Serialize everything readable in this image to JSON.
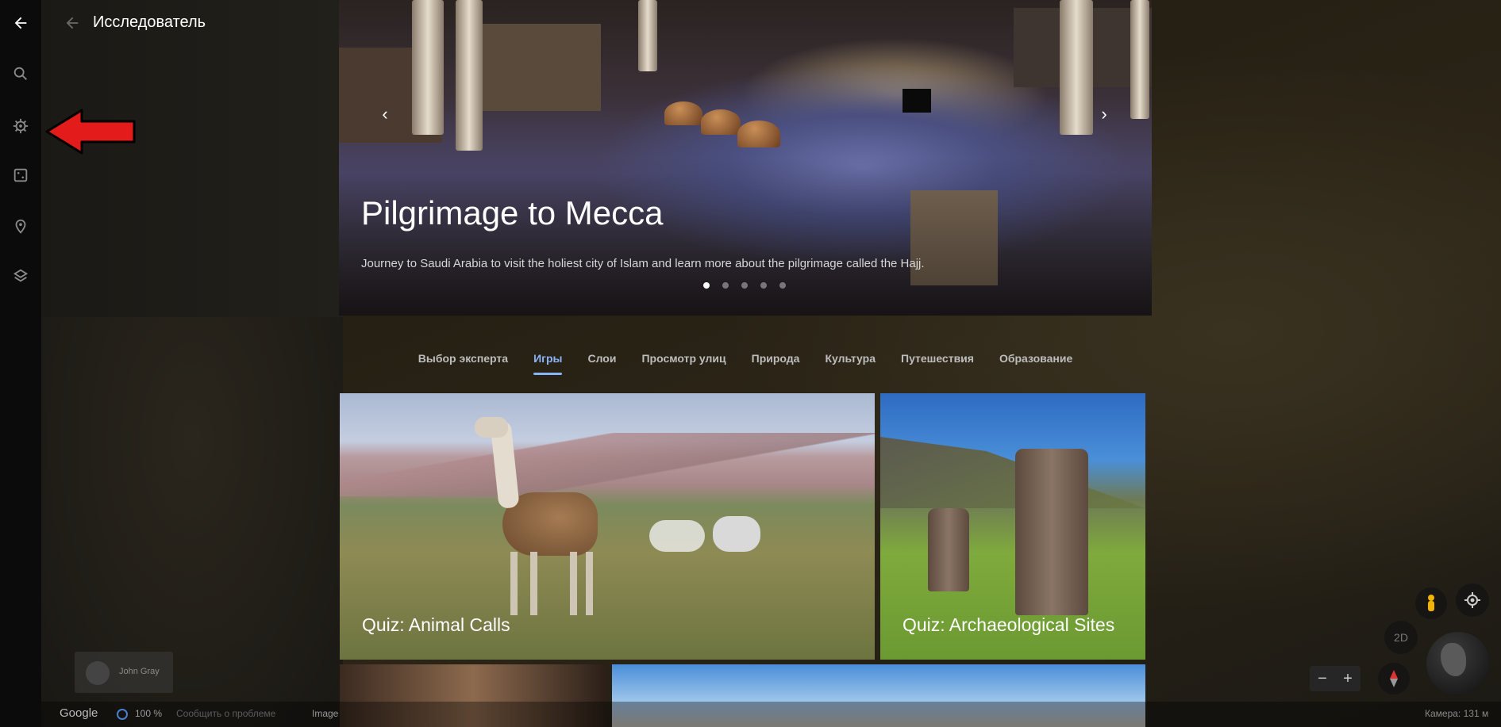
{
  "header": {
    "title": "Исследователь"
  },
  "rail": {
    "items": [
      "back-icon",
      "search-icon",
      "explorer-icon",
      "dice-icon",
      "place-icon",
      "layers-icon"
    ]
  },
  "hero": {
    "title": "Pilgrimage to Mecca",
    "description": "Journey to Saudi Arabia to visit the holiest city of Islam and learn more about the pilgrimage called the Hajj.",
    "prev_label": "‹",
    "next_label": "›",
    "slides_total": 5,
    "slide_active": 1
  },
  "tabs": [
    {
      "label": "Выбор эксперта",
      "active": false
    },
    {
      "label": "Игры",
      "active": true
    },
    {
      "label": "Слои",
      "active": false
    },
    {
      "label": "Просмотр улиц",
      "active": false
    },
    {
      "label": "Природа",
      "active": false
    },
    {
      "label": "Культура",
      "active": false
    },
    {
      "label": "Путешествия",
      "active": false
    },
    {
      "label": "Образование",
      "active": false
    }
  ],
  "cards": [
    {
      "label": "Quiz: Animal Calls"
    },
    {
      "label": "Quiz: Archaeological Sites"
    }
  ],
  "user": {
    "name": "John Gray"
  },
  "status": {
    "logo": "Google",
    "progress": "100 %",
    "report": "Сообщить о проблеме",
    "imagery": "Image",
    "camera": "Камера: 131 м"
  },
  "controls": {
    "mode": "2D",
    "zoom_out": "−",
    "zoom_in": "+"
  },
  "colors": {
    "accent": "#8ab4f8",
    "annotation": "#e31b1b"
  }
}
